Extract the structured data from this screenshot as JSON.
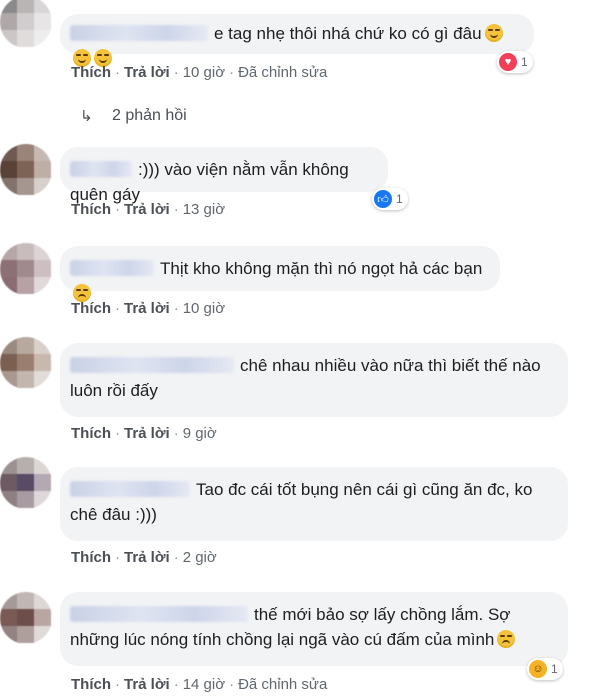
{
  "actions": {
    "like": "Thích",
    "reply": "Trả lời",
    "edited": "Đã chỉnh sửa",
    "sep": "·"
  },
  "comments": [
    {
      "text": "e tag nhẹ thôi nhá chứ ko có gì đâu",
      "time": "10 giờ",
      "edited": true,
      "reaction": {
        "icon": "heart-icon",
        "count": "1",
        "color": "#f33e58"
      }
    },
    {
      "text": ":))) vào viện nằm vẫn không quên gáy",
      "time": "13 giờ",
      "edited": false,
      "reaction": {
        "icon": "like-icon",
        "count": "1",
        "color": "#1877f2"
      }
    },
    {
      "text": "Thịt kho không mặn thì nó ngọt hả các bạn",
      "time": "10 giờ",
      "edited": false
    },
    {
      "text": "chê nhau nhiều vào nữa thì biết thế nào luôn rồi đấy",
      "time": "9 giờ",
      "edited": false
    },
    {
      "text": "Tao đc cái tốt bụng nên cái gì cũng ăn đc, ko chê đâu :)))",
      "time": "2 giờ",
      "edited": false
    },
    {
      "text": "thế mới bảo sợ lấy chồng lắm. Sợ những lúc nóng tính chồng lại ngã vào cú đấm của mình",
      "time": "14 giờ",
      "edited": true,
      "reaction": {
        "icon": "haha-icon",
        "count": "1",
        "color": "#f7b125"
      }
    }
  ],
  "replies_link": "2 phản hồi"
}
